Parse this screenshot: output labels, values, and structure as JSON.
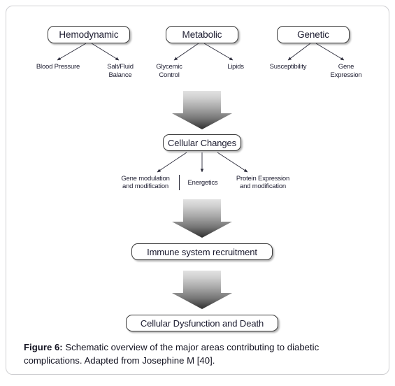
{
  "figure": {
    "caption_label": "Figure 6:",
    "caption_text": " Schematic overview of the major areas contributing to diabetic complications. Adapted from Josephine M [40]."
  },
  "diagram": {
    "top_nodes": [
      {
        "label": "Hemodynamic"
      },
      {
        "label": "Metabolic"
      },
      {
        "label": "Genetic"
      }
    ],
    "top_leaves": [
      {
        "line1": "Blood Pressure",
        "line2": ""
      },
      {
        "line1": "Salt/Fluid",
        "line2": "Balance"
      },
      {
        "line1": "Glycemic",
        "line2": "Control"
      },
      {
        "line1": "Lipids",
        "line2": ""
      },
      {
        "line1": "Susceptibility",
        "line2": ""
      },
      {
        "line1": "Gene",
        "line2": "Expression"
      }
    ],
    "cellular_changes": {
      "label": "Cellular Changes"
    },
    "mid_leaves": [
      {
        "line1": "Gene modulation",
        "line2": "and modification"
      },
      {
        "line1": "Energetics",
        "line2": ""
      },
      {
        "line1": "Protein Expression",
        "line2": "and modification"
      }
    ],
    "immune": {
      "label": "Immune system recruitment"
    },
    "outcome": {
      "label": "Cellular Dysfunction and Death"
    },
    "colors": {
      "arrow_gradient_top": "#dcdcdc",
      "arrow_gradient_bottom": "#3a3a3a",
      "node_border": "#3a3a3a",
      "text": "#1b1b2f",
      "frame_border": "#cfcfd2",
      "connector": "#2b2b3a"
    },
    "arrow_names": [
      "arrow-to-cellular-changes",
      "arrow-to-immune-system",
      "arrow-to-cellular-dysfunction"
    ]
  }
}
